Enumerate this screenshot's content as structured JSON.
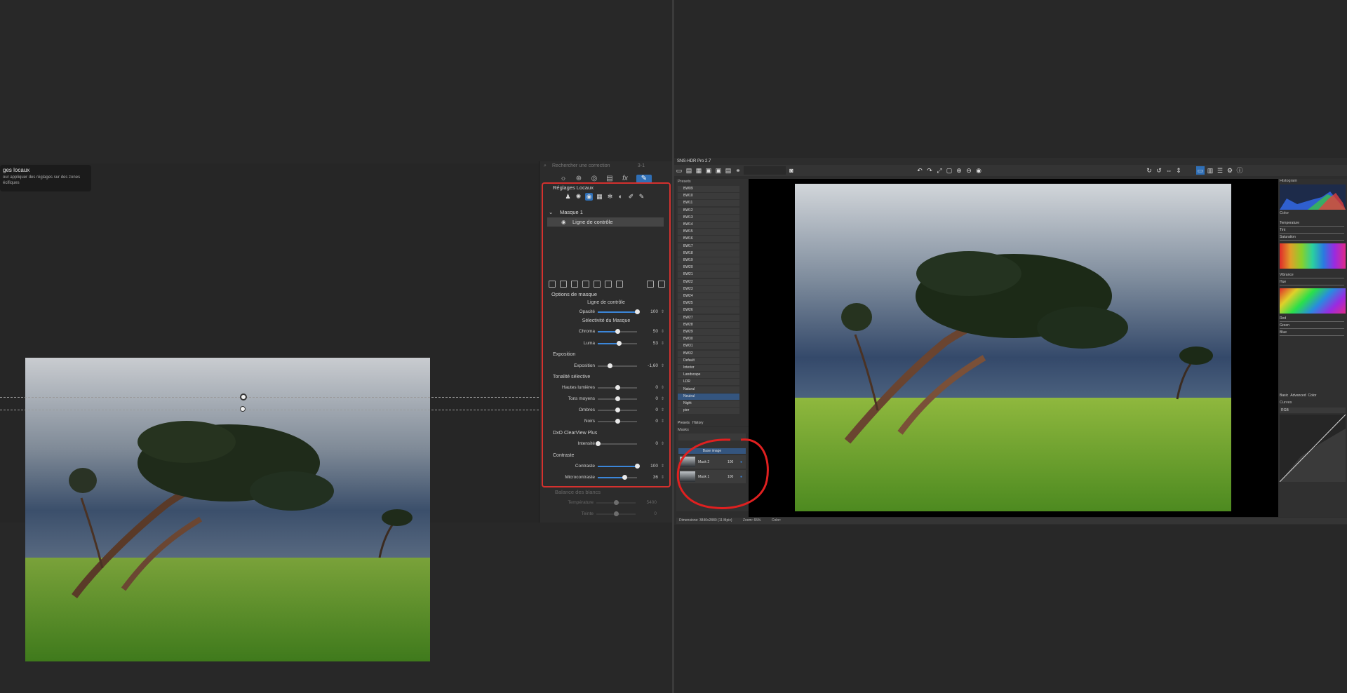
{
  "colors": {
    "accent": "#2f6fb6",
    "highlight_red": "#d4312e",
    "slider_fill": "#3b86d9"
  },
  "dxo": {
    "tooltip": {
      "title": "ges locaux",
      "body": "our appliquer des réglages sur des zones écifiques"
    },
    "search_placeholder": "Rechercher une correction",
    "search_count": "3-1",
    "tab_icons": [
      "sun-icon",
      "color-wheel-icon",
      "detail-icon",
      "geometry-icon",
      "fx-icon",
      "local-adjust-icon"
    ],
    "local": {
      "title": "Réglages Locaux",
      "mask_name": "Masque 1",
      "mask_sub": "Ligne de contrôle",
      "options_title": "Options de masque",
      "options_sub": "Ligne de contrôle",
      "opacity": {
        "label": "Opacité",
        "value": "100"
      },
      "selectivity_title": "Sélectivité du Masque",
      "chroma": {
        "label": "Chroma",
        "value": "50"
      },
      "luma": {
        "label": "Luma",
        "value": "53"
      },
      "exposure_title": "Exposition",
      "exposure": {
        "label": "Exposition",
        "value": "-1,60"
      },
      "tonality_title": "Tonalité sélective",
      "hautes": {
        "label": "Hautes lumières",
        "value": "0"
      },
      "tons": {
        "label": "Tons moyens",
        "value": "0"
      },
      "ombres": {
        "label": "Ombres",
        "value": "0"
      },
      "noirs": {
        "label": "Noirs",
        "value": "0"
      },
      "clearview_title": "DxO ClearView Plus",
      "intensite": {
        "label": "Intensité",
        "value": "0"
      },
      "contraste_title": "Contraste",
      "contraste": {
        "label": "Contraste",
        "value": "100"
      },
      "micro": {
        "label": "Microcontraste",
        "value": "36"
      }
    },
    "wb": {
      "title": "Balance des blancs",
      "temperature": {
        "label": "Température",
        "value": "5400"
      },
      "teinte": {
        "label": "Teinte",
        "value": "0"
      }
    }
  },
  "sns": {
    "title": "SNS-HDR Pro 2.7",
    "presets_label": "Presets",
    "presets": [
      "BW09",
      "BW10",
      "BW11",
      "BW12",
      "BW13",
      "BW14",
      "BW15",
      "BW16",
      "BW17",
      "BW18",
      "BW19",
      "BW20",
      "BW21",
      "BW22",
      "BW23",
      "BW24",
      "BW25",
      "BW26",
      "BW27",
      "BW28",
      "BW29",
      "BW30",
      "BW31",
      "BW32",
      "Default",
      "Interior",
      "Landscape",
      "LDR",
      "Natural",
      "Neutral",
      "Night",
      "pier"
    ],
    "selected_preset": "Neutral",
    "bottom_tabs": [
      "Presets",
      "History"
    ],
    "masks_label": "Masks",
    "base_image": "Base image",
    "masks": [
      {
        "name": "Mask 2",
        "value": "100"
      },
      {
        "name": "Mask 1",
        "value": "100"
      }
    ],
    "histogram_label": "Histogram",
    "color_label": "Color",
    "color_sliders": [
      "Temperature",
      "Tint",
      "Saturation"
    ],
    "vibrance_sliders": [
      "Vibrance",
      "Hue"
    ],
    "rgb_sliders": [
      "Red",
      "Green",
      "Blue"
    ],
    "mode_tabs": [
      "Basic",
      "Advanced",
      "Color"
    ],
    "curves_label": "Curves",
    "curve_channel": "RGB",
    "status": {
      "dimensions": "Dimensions: 3840x2880 (11 Mpix)",
      "zoom": "Zoom: 65%",
      "color": "Color:"
    }
  }
}
